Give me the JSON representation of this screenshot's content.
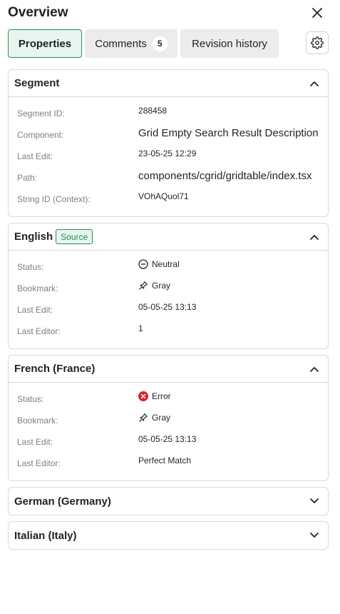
{
  "header": {
    "title": "Overview"
  },
  "tabs": {
    "properties": "Properties",
    "comments": "Comments",
    "comments_count": "5",
    "revision_history": "Revision history"
  },
  "segment": {
    "title": "Segment",
    "rows": [
      {
        "label": "Segment ID:",
        "value": "288458"
      },
      {
        "label": "Component:",
        "value": "Grid Empty Search Result Description"
      },
      {
        "label": "Last Edit:",
        "value": "23-05-25 12:29"
      },
      {
        "label": "Path:",
        "value": "components/cgrid/gridtable/index.tsx"
      },
      {
        "label": "String ID (Context):",
        "value": "VOhAQuol71"
      }
    ]
  },
  "english": {
    "title": "English",
    "badge": "Source",
    "rows": [
      {
        "label": "Status:",
        "value": "Neutral",
        "icon": "neutral-circle-icon"
      },
      {
        "label": "Bookmark:",
        "value": "Gray",
        "icon": "pin-icon"
      },
      {
        "label": "Last Edit:",
        "value": "05-05-25 13:13"
      },
      {
        "label": "Last Editor:",
        "value": "1"
      }
    ]
  },
  "french": {
    "title": "French (France)",
    "rows": [
      {
        "label": "Status:",
        "value": "Error",
        "icon": "error-circle-icon"
      },
      {
        "label": "Bookmark:",
        "value": "Gray",
        "icon": "pin-icon"
      },
      {
        "label": "Last Edit:",
        "value": "05-05-25 13:13"
      },
      {
        "label": "Last Editor:",
        "value": "Perfect Match"
      }
    ]
  },
  "german": {
    "title": "German (Germany)"
  },
  "italian": {
    "title": "Italian (Italy)"
  },
  "colors": {
    "accent": "#2f8a5a",
    "accent_bg": "#e8f5ee",
    "error": "#d9252b",
    "border": "#d7d9dc"
  }
}
